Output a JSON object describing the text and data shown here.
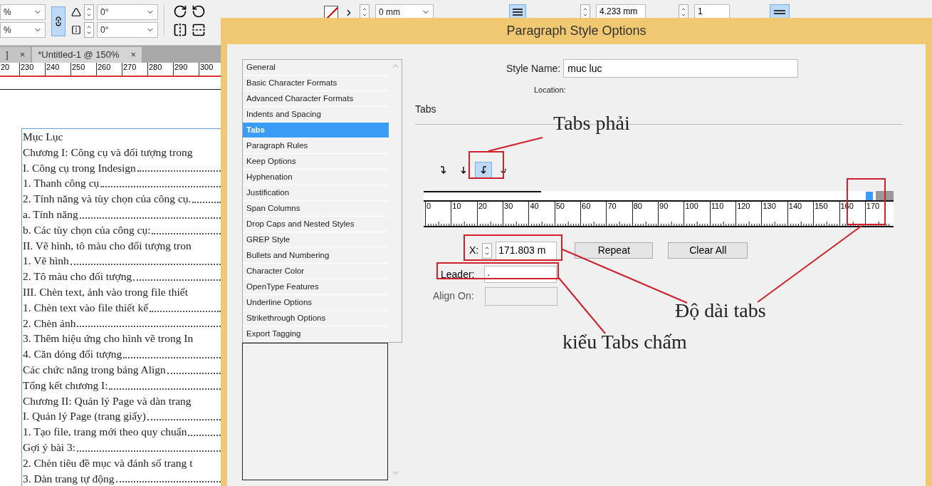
{
  "toolbar": {
    "scale_x": "%",
    "scale_y": "%",
    "constrain_on": true,
    "rotate_angle": "0°",
    "shear_angle": "0°",
    "stroke_weight": "0 mm",
    "leading": "4.233 mm",
    "columns": "1",
    "align_left_on": true,
    "single_line_on": true
  },
  "doc_tabs": [
    {
      "label": "]",
      "close": "×",
      "selected": false
    },
    {
      "label": "*Untitled-1 @ 150%",
      "close": "×",
      "selected": true
    }
  ],
  "doc_ruler": [
    "20",
    "230",
    "240",
    "250",
    "260",
    "270",
    "280",
    "290",
    "300"
  ],
  "document_lines": [
    {
      "text": "Mục Lục",
      "leader": false
    },
    {
      "text": "Chương I: Công cụ và đối tượng trong",
      "leader": false
    },
    {
      "text": "I. Công cụ trong Indesign",
      "leader": true
    },
    {
      "text": "1. Thanh công cụ",
      "leader": true
    },
    {
      "text": "2. Tính năng và tùy chọn của công cụ.",
      "leader": true
    },
    {
      "text": "a. Tính năng",
      "leader": true
    },
    {
      "text": "b. Các tùy chọn của công cụ:",
      "leader": true
    },
    {
      "text": "II. Vẽ hình, tô màu cho đối tượng tron",
      "leader": false
    },
    {
      "text": "1. Vẽ hình",
      "leader": true
    },
    {
      "text": "2. Tô màu cho đối tượng",
      "leader": true
    },
    {
      "text": "III. Chèn text, ảnh vào trong file thiết",
      "leader": false
    },
    {
      "text": "1. Chèn text vào file thiết kế",
      "leader": true
    },
    {
      "text": "2. Chèn ảnh",
      "leader": true
    },
    {
      "text": "3. Thêm hiệu ứng cho hình vẽ trong In",
      "leader": false
    },
    {
      "text": "4. Căn dóng đối tượng",
      "leader": true
    },
    {
      "text": "Các chức năng trong bảng Align",
      "leader": true
    },
    {
      "text": "Tổng kết chương I:",
      "leader": true
    },
    {
      "text": "Chương II: Quản lý Page và dàn trang",
      "leader": false
    },
    {
      "text": "I. Quản lý Page (trang giấy)",
      "leader": true
    },
    {
      "text": "1. Tạo file, trang mới theo quy chuẩn",
      "leader": true
    },
    {
      "text": "Gợi ý bài 3:",
      "leader": true
    },
    {
      "text": "2. Chèn tiêu đề mục và đánh số trang t",
      "leader": false
    },
    {
      "text": "3. Dàn trang tự động",
      "leader": true
    }
  ],
  "dialog": {
    "title": "Paragraph Style Options",
    "categories": [
      {
        "label": "General",
        "selected": false
      },
      {
        "label": "Basic Character Formats",
        "selected": false
      },
      {
        "label": "Advanced Character Formats",
        "selected": false
      },
      {
        "label": "Indents and Spacing",
        "selected": false
      },
      {
        "label": "Tabs",
        "selected": true
      },
      {
        "label": "Paragraph Rules",
        "selected": false
      },
      {
        "label": "Keep Options",
        "selected": false
      },
      {
        "label": "Hyphenation",
        "selected": false
      },
      {
        "label": "Justification",
        "selected": false
      },
      {
        "label": "Span Columns",
        "selected": false
      },
      {
        "label": "Drop Caps and Nested Styles",
        "selected": false
      },
      {
        "label": "GREP Style",
        "selected": false
      },
      {
        "label": "Bullets and Numbering",
        "selected": false
      },
      {
        "label": "Character Color",
        "selected": false
      },
      {
        "label": "OpenType Features",
        "selected": false
      },
      {
        "label": "Underline Options",
        "selected": false
      },
      {
        "label": "Strikethrough Options",
        "selected": false
      },
      {
        "label": "Export Tagging",
        "selected": false
      }
    ],
    "style_name_label": "Style Name:",
    "style_name": "muc luc",
    "location_label": "Location:",
    "section": "Tabs",
    "tab_alignments": [
      {
        "selected": false
      },
      {
        "selected": false
      },
      {
        "selected": true
      },
      {
        "selected": false
      }
    ],
    "tab_stop": {
      "level": 0.95
    },
    "ruler": [
      "0",
      "10",
      "20",
      "30",
      "40",
      "50",
      "60",
      "70",
      "80",
      "90",
      "100",
      "110",
      "120",
      "130",
      "140",
      "150",
      "160",
      "170"
    ],
    "x_label": "X:",
    "x_value": "171.803 m",
    "repeat": "Repeat",
    "clear_all": "Clear All",
    "leader_label": "Leader:",
    "leader_value": ".",
    "align_on_label": "Align On:",
    "align_on_disabled": true
  },
  "annotations": [
    {
      "text": "Tabs phải"
    },
    {
      "text": "Độ dài tabs"
    },
    {
      "text": "kiểu Tabs chấm"
    }
  ]
}
